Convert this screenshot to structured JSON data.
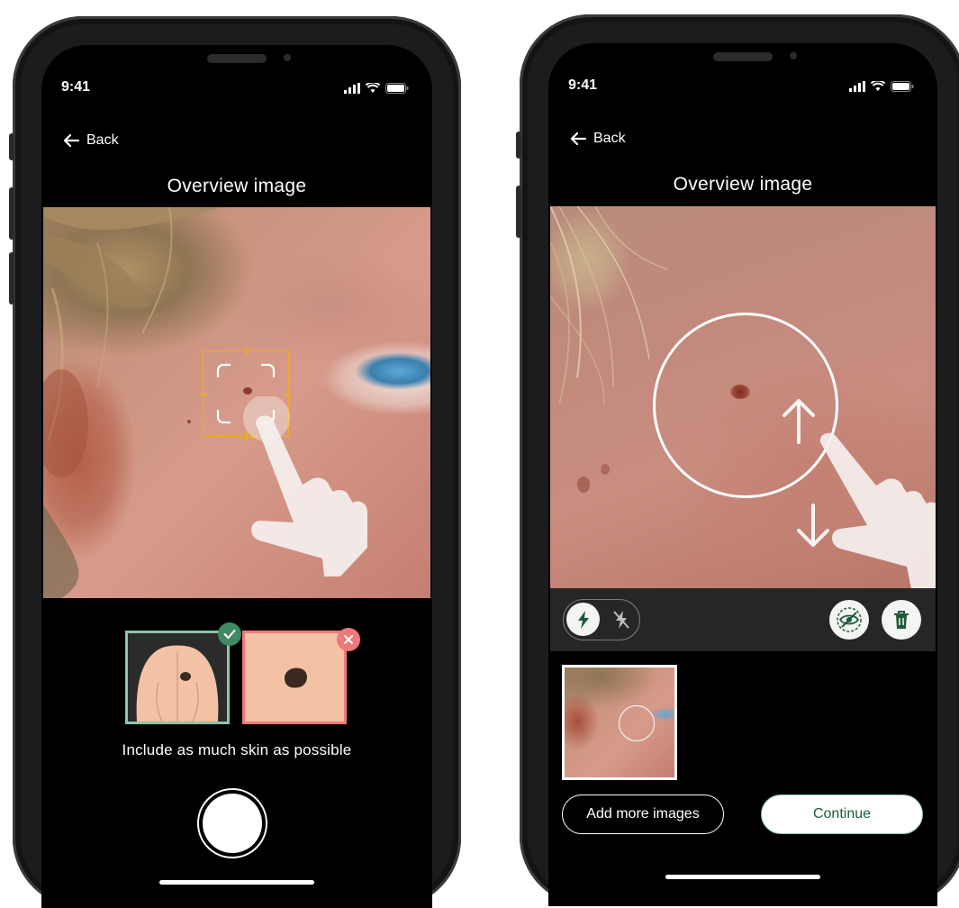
{
  "left_screen": {
    "time": "9:41",
    "back_label": "Back",
    "title": "Overview image",
    "hint": "Include as much skin as possible"
  },
  "right_screen": {
    "time": "9:41",
    "back_label": "Back",
    "title": "Overview image",
    "add_more_label": "Add more images",
    "continue_label": "Continue"
  },
  "colors": {
    "frame_orange": "#f0a92a",
    "good_green": "#3f8a63",
    "bad_red": "#f0787b",
    "skin_tone": "#f3c2a4",
    "continue_text": "#1e5a3a"
  },
  "icons": [
    "back-arrow-icon",
    "signal-icon",
    "wifi-icon",
    "battery-icon",
    "check-icon",
    "x-icon",
    "flash-on-icon",
    "flash-off-icon",
    "hide-icon",
    "trash-icon",
    "hand-pointer-icon",
    "resize-arrow-icon"
  ]
}
